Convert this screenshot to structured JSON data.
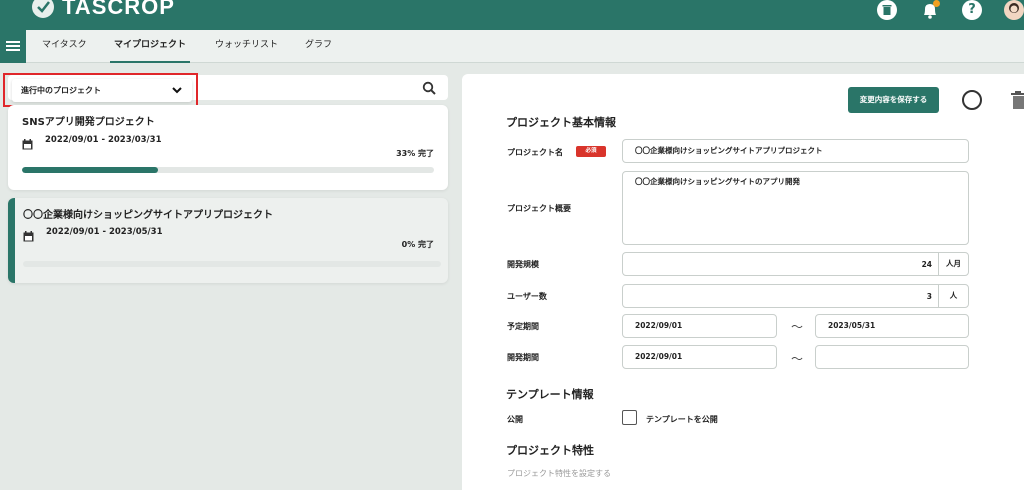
{
  "app": {
    "logo_text": "TASCROP",
    "brand_color": "#2a7568",
    "header_icons": [
      "trash-icon",
      "bell-icon",
      "help-icon",
      "avatar"
    ]
  },
  "nav": {
    "tabs": [
      {
        "label": "マイタスク",
        "active": false
      },
      {
        "label": "マイプロジェクト",
        "active": true
      },
      {
        "label": "ウォッチリスト",
        "active": false
      },
      {
        "label": "グラフ",
        "active": false
      }
    ]
  },
  "filter": {
    "selected": "進行中のプロジェクト"
  },
  "projects": [
    {
      "title": "SNSアプリ開発プロジェクト",
      "dates": "2022/09/01 - 2023/03/31",
      "progress_label": "33% 完了",
      "progress": 0.33
    },
    {
      "title": "〇〇企業様向けショッピングサイトアプリプロジェクト",
      "dates": "2022/09/01 - 2023/05/31",
      "progress_label": "0% 完了",
      "progress": 0.0
    }
  ],
  "detail": {
    "save_label": "変更内容を保存する",
    "basic_section": "プロジェクト基本情報",
    "name_label": "プロジェクト名",
    "required_badge": "必須",
    "name_value": "〇〇企業様向けショッピングサイトアプリプロジェクト",
    "summary_label": "プロジェクト概要",
    "summary_value": "〇〇企業様向けショッピングサイトのアプリ開発",
    "scale_label": "開発規模",
    "scale_value": "24",
    "scale_unit": "人月",
    "users_label": "ユーザー数",
    "users_value": "3",
    "users_unit": "人",
    "planned_label": "予定期間",
    "planned_start": "2022/09/01",
    "planned_end": "2023/05/31",
    "actual_label": "開発期間",
    "actual_start": "2022/09/01",
    "actual_end": "",
    "tilde": "〜",
    "template_section": "テンプレート情報",
    "public_label": "公開",
    "publish_checkbox_label": "テンプレートを公開",
    "traits_section": "プロジェクト特性",
    "traits_link": "プロジェクト特性を設定する"
  }
}
